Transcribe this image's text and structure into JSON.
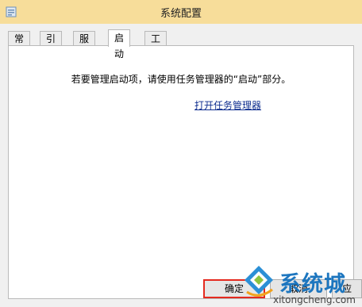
{
  "window": {
    "title": "系统配置",
    "title_bar_color": "#f7dd9a"
  },
  "tabs": [
    {
      "label": "常规",
      "active": false
    },
    {
      "label": "引导",
      "active": false
    },
    {
      "label": "服务",
      "active": false
    },
    {
      "label": "启动",
      "active": true
    },
    {
      "label": "工具",
      "active": false
    }
  ],
  "startup_panel": {
    "hint": "若要管理启动项，请使用任务管理器的“启动”部分。",
    "link": "打开任务管理器"
  },
  "buttons": {
    "ok": "确定",
    "cancel": "取消",
    "apply": "应"
  },
  "watermark": {
    "brand": "系统城",
    "url": "xitongcheng.com",
    "color": "#1d76bf"
  }
}
